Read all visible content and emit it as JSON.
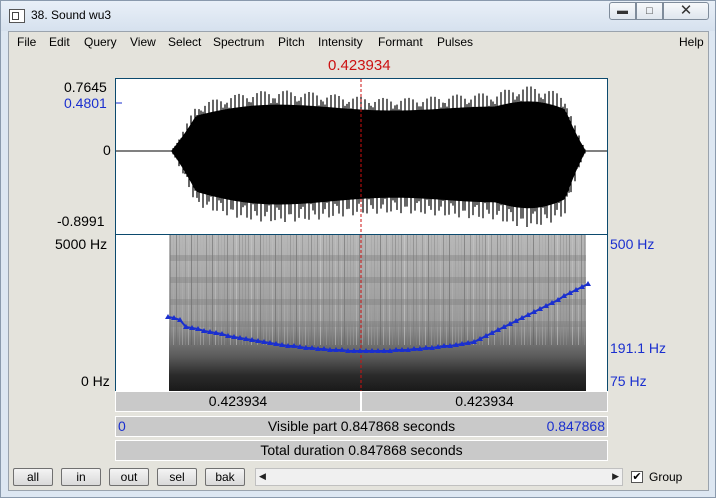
{
  "window": {
    "title": "38. Sound wu3",
    "min_icon": "minimize-icon",
    "max_icon": "maximize-icon",
    "close_icon": "close-icon"
  },
  "menu": {
    "items": [
      "File",
      "Edit",
      "Query",
      "View",
      "Select",
      "Spectrum",
      "Pitch",
      "Intensity",
      "Formant",
      "Pulses"
    ],
    "help": "Help"
  },
  "cursor": {
    "time": "0.423934",
    "color": "#cc1111"
  },
  "waveform": {
    "max": "0.7645",
    "cursor_value": "0.4801",
    "zero": "0",
    "min": "-0.8991"
  },
  "spectrogram": {
    "freq_top": "5000 Hz",
    "freq_bottom": "0 Hz",
    "pitch_top": "500 Hz",
    "pitch_cursor": "191.1 Hz",
    "pitch_bottom": "75 Hz",
    "pitch_color": "#1a2fcf"
  },
  "bars": {
    "left_segment": "0.423934",
    "right_segment": "0.423934",
    "visible_start": "0",
    "visible_part": "Visible part 0.847868 seconds",
    "visible_end": "0.847868",
    "total": "Total duration 0.847868 seconds"
  },
  "buttons": {
    "all": "all",
    "in": "in",
    "out": "out",
    "sel": "sel",
    "bak": "bak"
  },
  "group": {
    "label": "Group",
    "checked": true,
    "check_glyph": "✔"
  }
}
